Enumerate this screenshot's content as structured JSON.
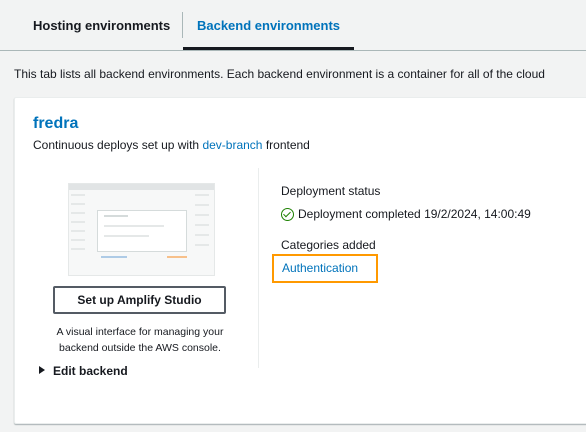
{
  "tabs": {
    "hosting": "Hosting environments",
    "backend": "Backend environments"
  },
  "description": "This tab lists all backend environments. Each backend environment is a container for all of the cloud",
  "environment": {
    "name": "fredra",
    "desc_prefix": "Continuous deploys set up with ",
    "branch": "dev-branch",
    "desc_suffix": " frontend"
  },
  "studio": {
    "button_label": "Set up Amplify Studio",
    "help_line1": "A visual interface for managing your",
    "help_line2": "backend outside the AWS console."
  },
  "edit_backend_label": "Edit backend",
  "deployment": {
    "status_label": "Deployment status",
    "status_value": "Deployment completed 19/2/2024, 14:00:49",
    "categories_label": "Categories added",
    "category_link": "Authentication"
  },
  "colors": {
    "accent": "#0073bb",
    "success": "#1d8102",
    "highlight": "#ff9900"
  }
}
